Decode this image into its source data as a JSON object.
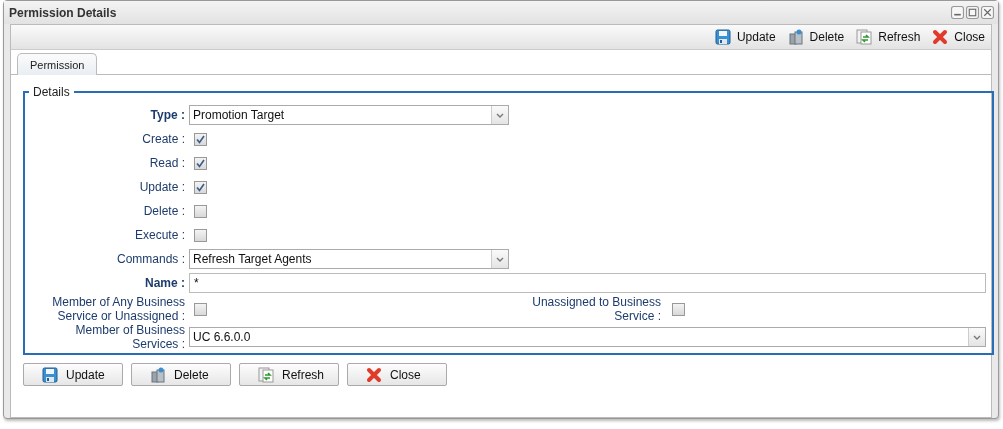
{
  "window": {
    "title": "Permission Details"
  },
  "toolbar": [
    {
      "kind": "update",
      "label": "Update"
    },
    {
      "kind": "delete",
      "label": "Delete"
    },
    {
      "kind": "refresh",
      "label": "Refresh"
    },
    {
      "kind": "close",
      "label": "Close"
    }
  ],
  "tabs": [
    {
      "label": "Permission",
      "selected": true
    }
  ],
  "details": {
    "legend": "Details",
    "rows": [
      [
        {
          "kind": "select",
          "label": "Type :",
          "bold": true,
          "value": "Promotion Target"
        }
      ],
      [
        {
          "kind": "checkbox",
          "label": "Create :",
          "bold": false,
          "checked": true
        }
      ],
      [
        {
          "kind": "checkbox",
          "label": "Read :",
          "bold": false,
          "checked": true
        }
      ],
      [
        {
          "kind": "checkbox",
          "label": "Update :",
          "bold": false,
          "checked": true
        }
      ],
      [
        {
          "kind": "checkbox",
          "label": "Delete :",
          "bold": false,
          "checked": false
        }
      ],
      [
        {
          "kind": "checkbox",
          "label": "Execute :",
          "bold": false,
          "checked": false
        }
      ],
      [
        {
          "kind": "select",
          "label": "Commands :",
          "bold": false,
          "value": "Refresh Target Agents"
        }
      ],
      [
        {
          "kind": "text",
          "label": "Name :",
          "bold": true,
          "value": "*"
        }
      ],
      [
        {
          "kind": "checkbox",
          "label": "Member of Any Business Service or Unassigned :",
          "bold": false,
          "checked": false
        },
        {
          "kind": "checkbox",
          "label": "Unassigned to Business Service :",
          "bold": false,
          "checked": false
        }
      ],
      [
        {
          "kind": "list",
          "label": "Member of Business Services :",
          "bold": false,
          "value": "UC 6.6.0.0"
        }
      ]
    ]
  },
  "buttons": [
    {
      "kind": "update",
      "label": "Update"
    },
    {
      "kind": "delete",
      "label": "Delete"
    },
    {
      "kind": "refresh",
      "label": "Refresh"
    },
    {
      "kind": "close",
      "label": "Close"
    }
  ]
}
